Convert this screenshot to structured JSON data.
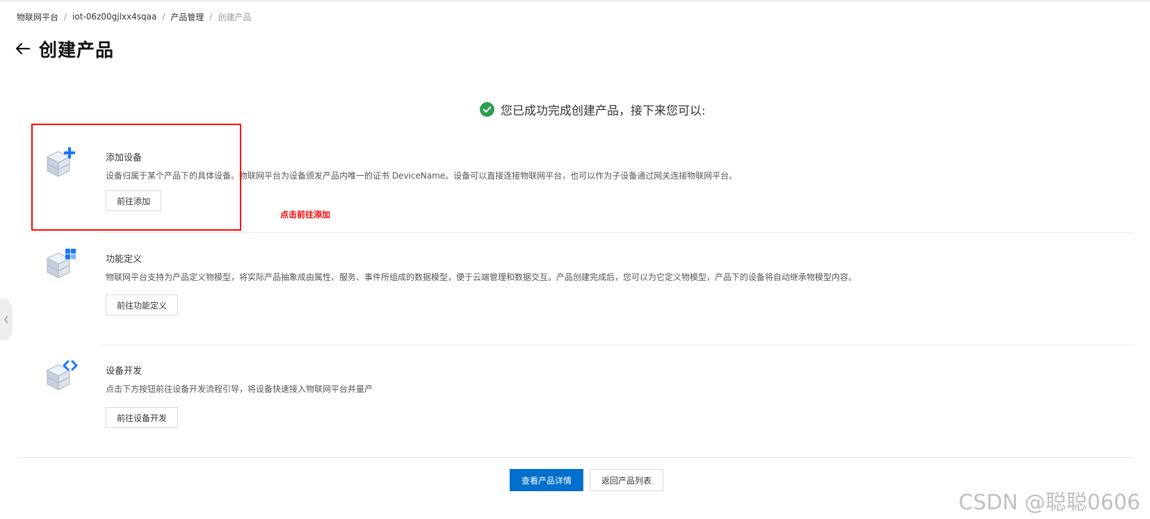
{
  "breadcrumb": {
    "items": [
      "物联网平台",
      "iot-06z00gjlxx4sqaa",
      "产品管理"
    ],
    "current": "创建产品",
    "separator": "/"
  },
  "page": {
    "title": "创建产品"
  },
  "success": {
    "message": "您已成功完成创建产品，接下来您可以:",
    "color": "#2e9e4f"
  },
  "steps": [
    {
      "title": "添加设备",
      "description": "设备归属于某个产品下的具体设备。物联网平台为设备颁发产品内唯一的证书 DeviceName。设备可以直接连接物联网平台，也可以作为子设备通过网关连接物联网平台。",
      "button": "前往添加",
      "icon": "cube-add-icon"
    },
    {
      "title": "功能定义",
      "description": "物联网平台支持为产品定义物模型，将实际产品抽象成由属性、服务、事件所组成的数据模型，便于云端管理和数据交互。产品创建完成后，您可以为它定义物模型，产品下的设备将自动继承物模型内容。",
      "button": "前往功能定义",
      "icon": "cube-grid-icon"
    },
    {
      "title": "设备开发",
      "description": "点击下方按钮前往设备开发流程引导，将设备快速接入物联网平台并量产",
      "button": "前往设备开发",
      "icon": "cube-code-icon"
    }
  ],
  "annotation": {
    "text": "点击前往添加",
    "color": "#ff0000"
  },
  "footer": {
    "primary_button": "查看产品详情",
    "secondary_button": "返回产品列表",
    "primary_color": "#0070cc"
  },
  "watermark": "CSDN @聪聪0606"
}
